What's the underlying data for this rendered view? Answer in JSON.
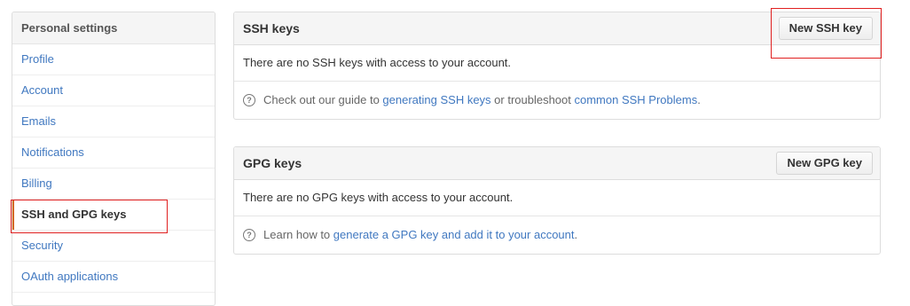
{
  "sidebar": {
    "header": "Personal settings",
    "items": [
      {
        "label": "Profile"
      },
      {
        "label": "Account"
      },
      {
        "label": "Emails"
      },
      {
        "label": "Notifications"
      },
      {
        "label": "Billing"
      },
      {
        "label": "SSH and GPG keys",
        "selected": true
      },
      {
        "label": "Security"
      },
      {
        "label": "OAuth applications"
      }
    ]
  },
  "ssh": {
    "title": "SSH keys",
    "button": "New SSH key",
    "empty": "There are no SSH keys with access to your account.",
    "help": {
      "prefix": "Check out our guide to ",
      "link1": "generating SSH keys",
      "middle": " or troubleshoot ",
      "link2": "common SSH Problems",
      "suffix": "."
    }
  },
  "gpg": {
    "title": "GPG keys",
    "button": "New GPG key",
    "empty": "There are no GPG keys with access to your account.",
    "help": {
      "prefix": "Learn how to ",
      "link1": "generate a GPG key and add it to your account",
      "suffix": "."
    }
  },
  "colors": {
    "link": "#4078c0",
    "selected_marker": "#d26911",
    "annotation": "#e02020"
  },
  "icons": {
    "help": "question-circle-icon"
  }
}
